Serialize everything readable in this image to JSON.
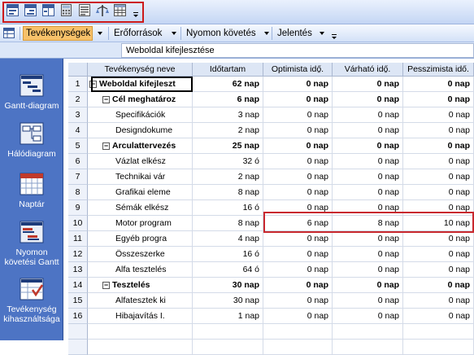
{
  "toolbar1": {
    "buttons": [
      {
        "name": "outline-indent-icon"
      },
      {
        "name": "outline-outdent-icon"
      },
      {
        "name": "task-split-icon"
      },
      {
        "name": "calculator-icon"
      },
      {
        "name": "task-info-icon"
      },
      {
        "name": "pert-analysis-icon"
      },
      {
        "name": "table-icon"
      }
    ]
  },
  "toolbar2": {
    "menus": [
      {
        "label": "Tevékenységek",
        "active": true
      },
      {
        "label": "Erőforrások",
        "active": false
      },
      {
        "label": "Nyomon követés",
        "active": false
      },
      {
        "label": "Jelentés",
        "active": false
      }
    ]
  },
  "entry_bar": {
    "value": "Weboldal kifejlesztése"
  },
  "viewbar": {
    "items": [
      {
        "label": "Gantt-diagram",
        "icon": "gantt-chart-icon"
      },
      {
        "label": "Hálódiagram",
        "icon": "network-diagram-icon"
      },
      {
        "label": "Naptár",
        "icon": "calendar-icon"
      },
      {
        "label": "Nyomon követési Gantt",
        "icon": "tracking-gantt-icon"
      },
      {
        "label": "Tevékenység kihasználtsága",
        "icon": "task-usage-icon"
      }
    ]
  },
  "table": {
    "headers": [
      "Tevékenység neve",
      "Időtartam",
      "Optimista idő̱.",
      "Várható idő̱.",
      "Pesszimista idő."
    ],
    "rows": [
      {
        "n": "1",
        "name": "Weboldal kifejleszt",
        "level": 0,
        "summary": true,
        "dur": "62 nap",
        "opt": "0 nap",
        "exp": "0 nap",
        "pes": "0 nap"
      },
      {
        "n": "2",
        "name": "Cél meghatároz",
        "level": 1,
        "summary": true,
        "dur": "6 nap",
        "opt": "0 nap",
        "exp": "0 nap",
        "pes": "0 nap"
      },
      {
        "n": "3",
        "name": "Specifikációk",
        "level": 2,
        "summary": false,
        "dur": "3 nap",
        "opt": "0 nap",
        "exp": "0 nap",
        "pes": "0 nap"
      },
      {
        "n": "4",
        "name": "Designdokume",
        "level": 2,
        "summary": false,
        "dur": "2 nap",
        "opt": "0 nap",
        "exp": "0 nap",
        "pes": "0 nap"
      },
      {
        "n": "5",
        "name": "Arculattervezés",
        "level": 1,
        "summary": true,
        "dur": "25 nap",
        "opt": "0 nap",
        "exp": "0 nap",
        "pes": "0 nap"
      },
      {
        "n": "6",
        "name": "Vázlat elkész",
        "level": 2,
        "summary": false,
        "dur": "32 ó",
        "opt": "0 nap",
        "exp": "0 nap",
        "pes": "0 nap"
      },
      {
        "n": "7",
        "name": "Technikai vár",
        "level": 2,
        "summary": false,
        "dur": "2 nap",
        "opt": "0 nap",
        "exp": "0 nap",
        "pes": "0 nap"
      },
      {
        "n": "8",
        "name": "Grafikai eleme",
        "level": 2,
        "summary": false,
        "dur": "8 nap",
        "opt": "0 nap",
        "exp": "0 nap",
        "pes": "0 nap"
      },
      {
        "n": "9",
        "name": "Sémák elkész",
        "level": 2,
        "summary": false,
        "dur": "16 ó",
        "opt": "0 nap",
        "exp": "0 nap",
        "pes": "0 nap"
      },
      {
        "n": "10",
        "name": "Motor program",
        "level": 2,
        "summary": false,
        "dur": "8 nap",
        "opt": "6 nap",
        "exp": "8 nap",
        "pes": "10 nap"
      },
      {
        "n": "11",
        "name": "Egyéb progra",
        "level": 2,
        "summary": false,
        "dur": "4 nap",
        "opt": "0 nap",
        "exp": "0 nap",
        "pes": "0 nap"
      },
      {
        "n": "12",
        "name": "Összeszerke",
        "level": 2,
        "summary": false,
        "dur": "16 ó",
        "opt": "0 nap",
        "exp": "0 nap",
        "pes": "0 nap"
      },
      {
        "n": "13",
        "name": "Alfa tesztelés",
        "level": 2,
        "summary": false,
        "dur": "64 ó",
        "opt": "0 nap",
        "exp": "0 nap",
        "pes": "0 nap"
      },
      {
        "n": "14",
        "name": "Tesztelés",
        "level": 1,
        "summary": true,
        "dur": "30 nap",
        "opt": "0 nap",
        "exp": "0 nap",
        "pes": "0 nap"
      },
      {
        "n": "15",
        "name": "Alfatesztek ki",
        "level": 2,
        "summary": false,
        "dur": "30 nap",
        "opt": "0 nap",
        "exp": "0 nap",
        "pes": "0 nap"
      },
      {
        "n": "16",
        "name": "Hibajavítás I.",
        "level": 2,
        "summary": false,
        "dur": "1 nap",
        "opt": "0 nap",
        "exp": "0 nap",
        "pes": "0 nap"
      }
    ]
  },
  "colors": {
    "highlight": "#c8282e",
    "viewbar": "#4d74c4",
    "active_menu": "#f7c16a"
  }
}
